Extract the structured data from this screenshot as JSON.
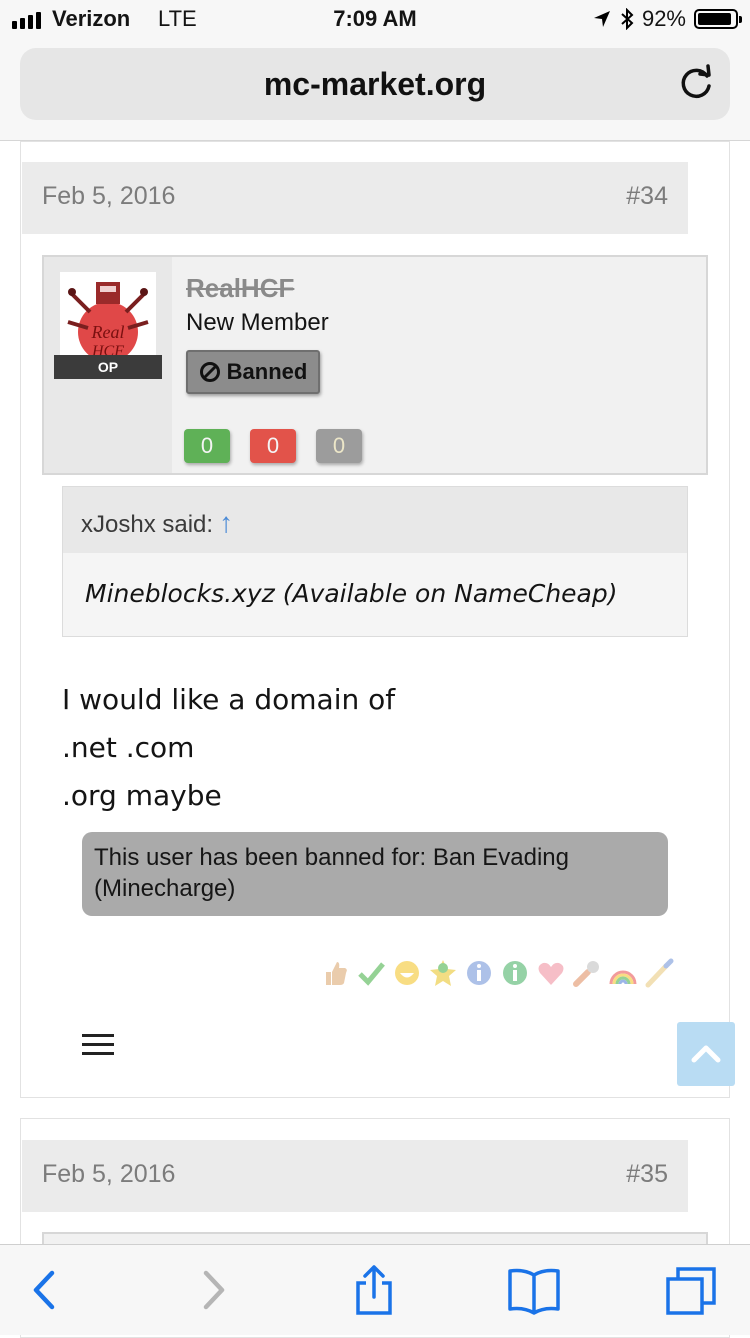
{
  "status_bar": {
    "carrier": "Verizon",
    "network": "LTE",
    "time": "7:09 AM",
    "battery": "92%",
    "battery_level": 0.92,
    "icons": [
      "signal-bars-icon",
      "location-arrow-icon",
      "bluetooth-icon",
      "battery-icon"
    ]
  },
  "address_bar": {
    "url": "mc-market.org",
    "reload_icon": "reload-icon"
  },
  "posts": [
    {
      "date": "Feb 5, 2016",
      "number": "#34",
      "user": {
        "name": "RealHCF",
        "title": "New Member",
        "op_badge": "OP",
        "banned_label": "Banned",
        "ratings": {
          "positive": "0",
          "negative": "0",
          "neutral": "0"
        }
      },
      "quote": {
        "author": "xJoshx said:",
        "arrow": "↑",
        "text": "Mineblocks.xyz (Available on NameCheap)"
      },
      "message_lines": [
        "I would like a domain of",
        ".net .com",
        ".org maybe"
      ],
      "ban_notice": "This user has been banned for: Ban Evading (Minecharge)",
      "reaction_icons": [
        "thumbs-up-icon",
        "check-icon",
        "smile-icon",
        "star-icon",
        "info-icon",
        "info-green-icon",
        "heart-icon",
        "wrench-icon",
        "rainbow-icon",
        "paintbrush-icon"
      ]
    },
    {
      "date": "Feb 5, 2016",
      "number": "#35"
    }
  ],
  "colors": {
    "rating_positive": "#5fb157",
    "rating_negative": "#e2534a",
    "rating_neutral": "#9c9c9c",
    "link_blue": "#4a8ad6",
    "toolbar_blue": "#1a73e8"
  },
  "toolbar": {
    "buttons": [
      "back-icon",
      "forward-icon",
      "share-icon",
      "bookmarks-icon",
      "tabs-icon"
    ]
  }
}
